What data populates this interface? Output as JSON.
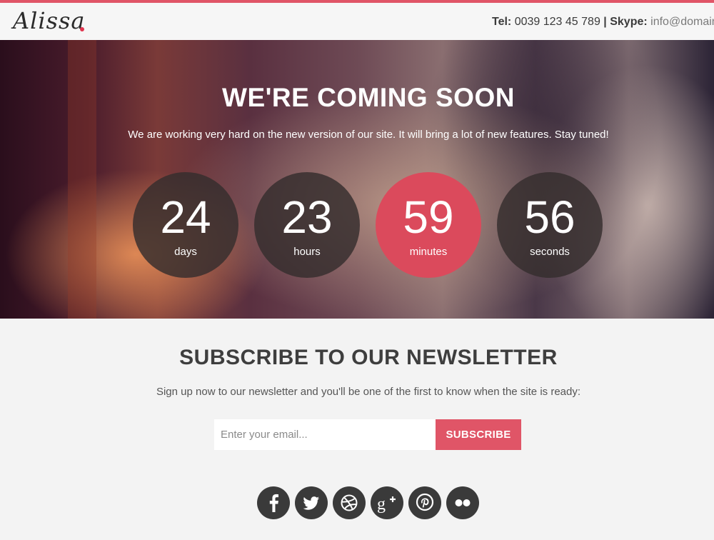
{
  "brand": {
    "name": "Alissa",
    "dot_color": "#e0344e"
  },
  "header": {
    "tel_label": "Tel:",
    "tel_value": "0039 123 45 789",
    "separator": "|",
    "skype_label": "Skype:",
    "skype_value": "info@domain."
  },
  "hero": {
    "title": "WE'RE COMING SOON",
    "subtitle": "We are working very hard on the new version of our site. It will bring a lot of new features. Stay tuned!"
  },
  "countdown": [
    {
      "value": "24",
      "unit": "days"
    },
    {
      "value": "23",
      "unit": "hours"
    },
    {
      "value": "59",
      "unit": "minutes"
    },
    {
      "value": "56",
      "unit": "seconds"
    }
  ],
  "newsletter": {
    "title": "SUBSCRIBE TO OUR NEWSLETTER",
    "text": "Sign up now to our newsletter and you'll be one of the first to know when the site is ready:",
    "placeholder": "Enter your email...",
    "button": "SUBSCRIBE"
  },
  "social": [
    {
      "icon": "facebook-icon"
    },
    {
      "icon": "twitter-icon"
    },
    {
      "icon": "dribbble-icon"
    },
    {
      "icon": "google-plus-icon"
    },
    {
      "icon": "pinterest-icon"
    },
    {
      "icon": "flickr-icon"
    }
  ],
  "colors": {
    "accent": "#e05567",
    "circle_dark": "#342d2d",
    "social": "#3a3a3a"
  }
}
